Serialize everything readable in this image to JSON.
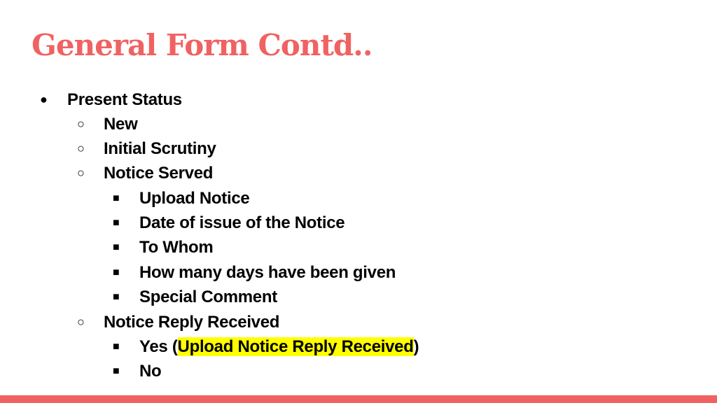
{
  "slide": {
    "title": "General Form Contd..",
    "accent_color": "#f06262",
    "highlight_color": "#ffff00"
  },
  "list": {
    "heading": {
      "bullet": "●",
      "label": "Present Status"
    },
    "status_options": [
      {
        "bullet": "○",
        "label": "New"
      },
      {
        "bullet": "○",
        "label": "Initial Scrutiny"
      },
      {
        "bullet": "○",
        "label": "Notice Served"
      }
    ],
    "notice_served_fields": [
      {
        "bullet": "■",
        "label": "Upload Notice"
      },
      {
        "bullet": "■",
        "label": "Date of issue of the Notice"
      },
      {
        "bullet": "■",
        "label": "To Whom"
      },
      {
        "bullet": "■",
        "label": "How many days have been given"
      },
      {
        "bullet": "■",
        "label": "Special Comment"
      }
    ],
    "reply_status": {
      "bullet": "○",
      "label": "Notice Reply Received"
    },
    "reply_options": {
      "yes": {
        "bullet": "■",
        "prefix": "Yes (",
        "highlighted": "Upload Notice Reply Received",
        "suffix": ")"
      },
      "no": {
        "bullet": "■",
        "label": "No"
      }
    }
  }
}
